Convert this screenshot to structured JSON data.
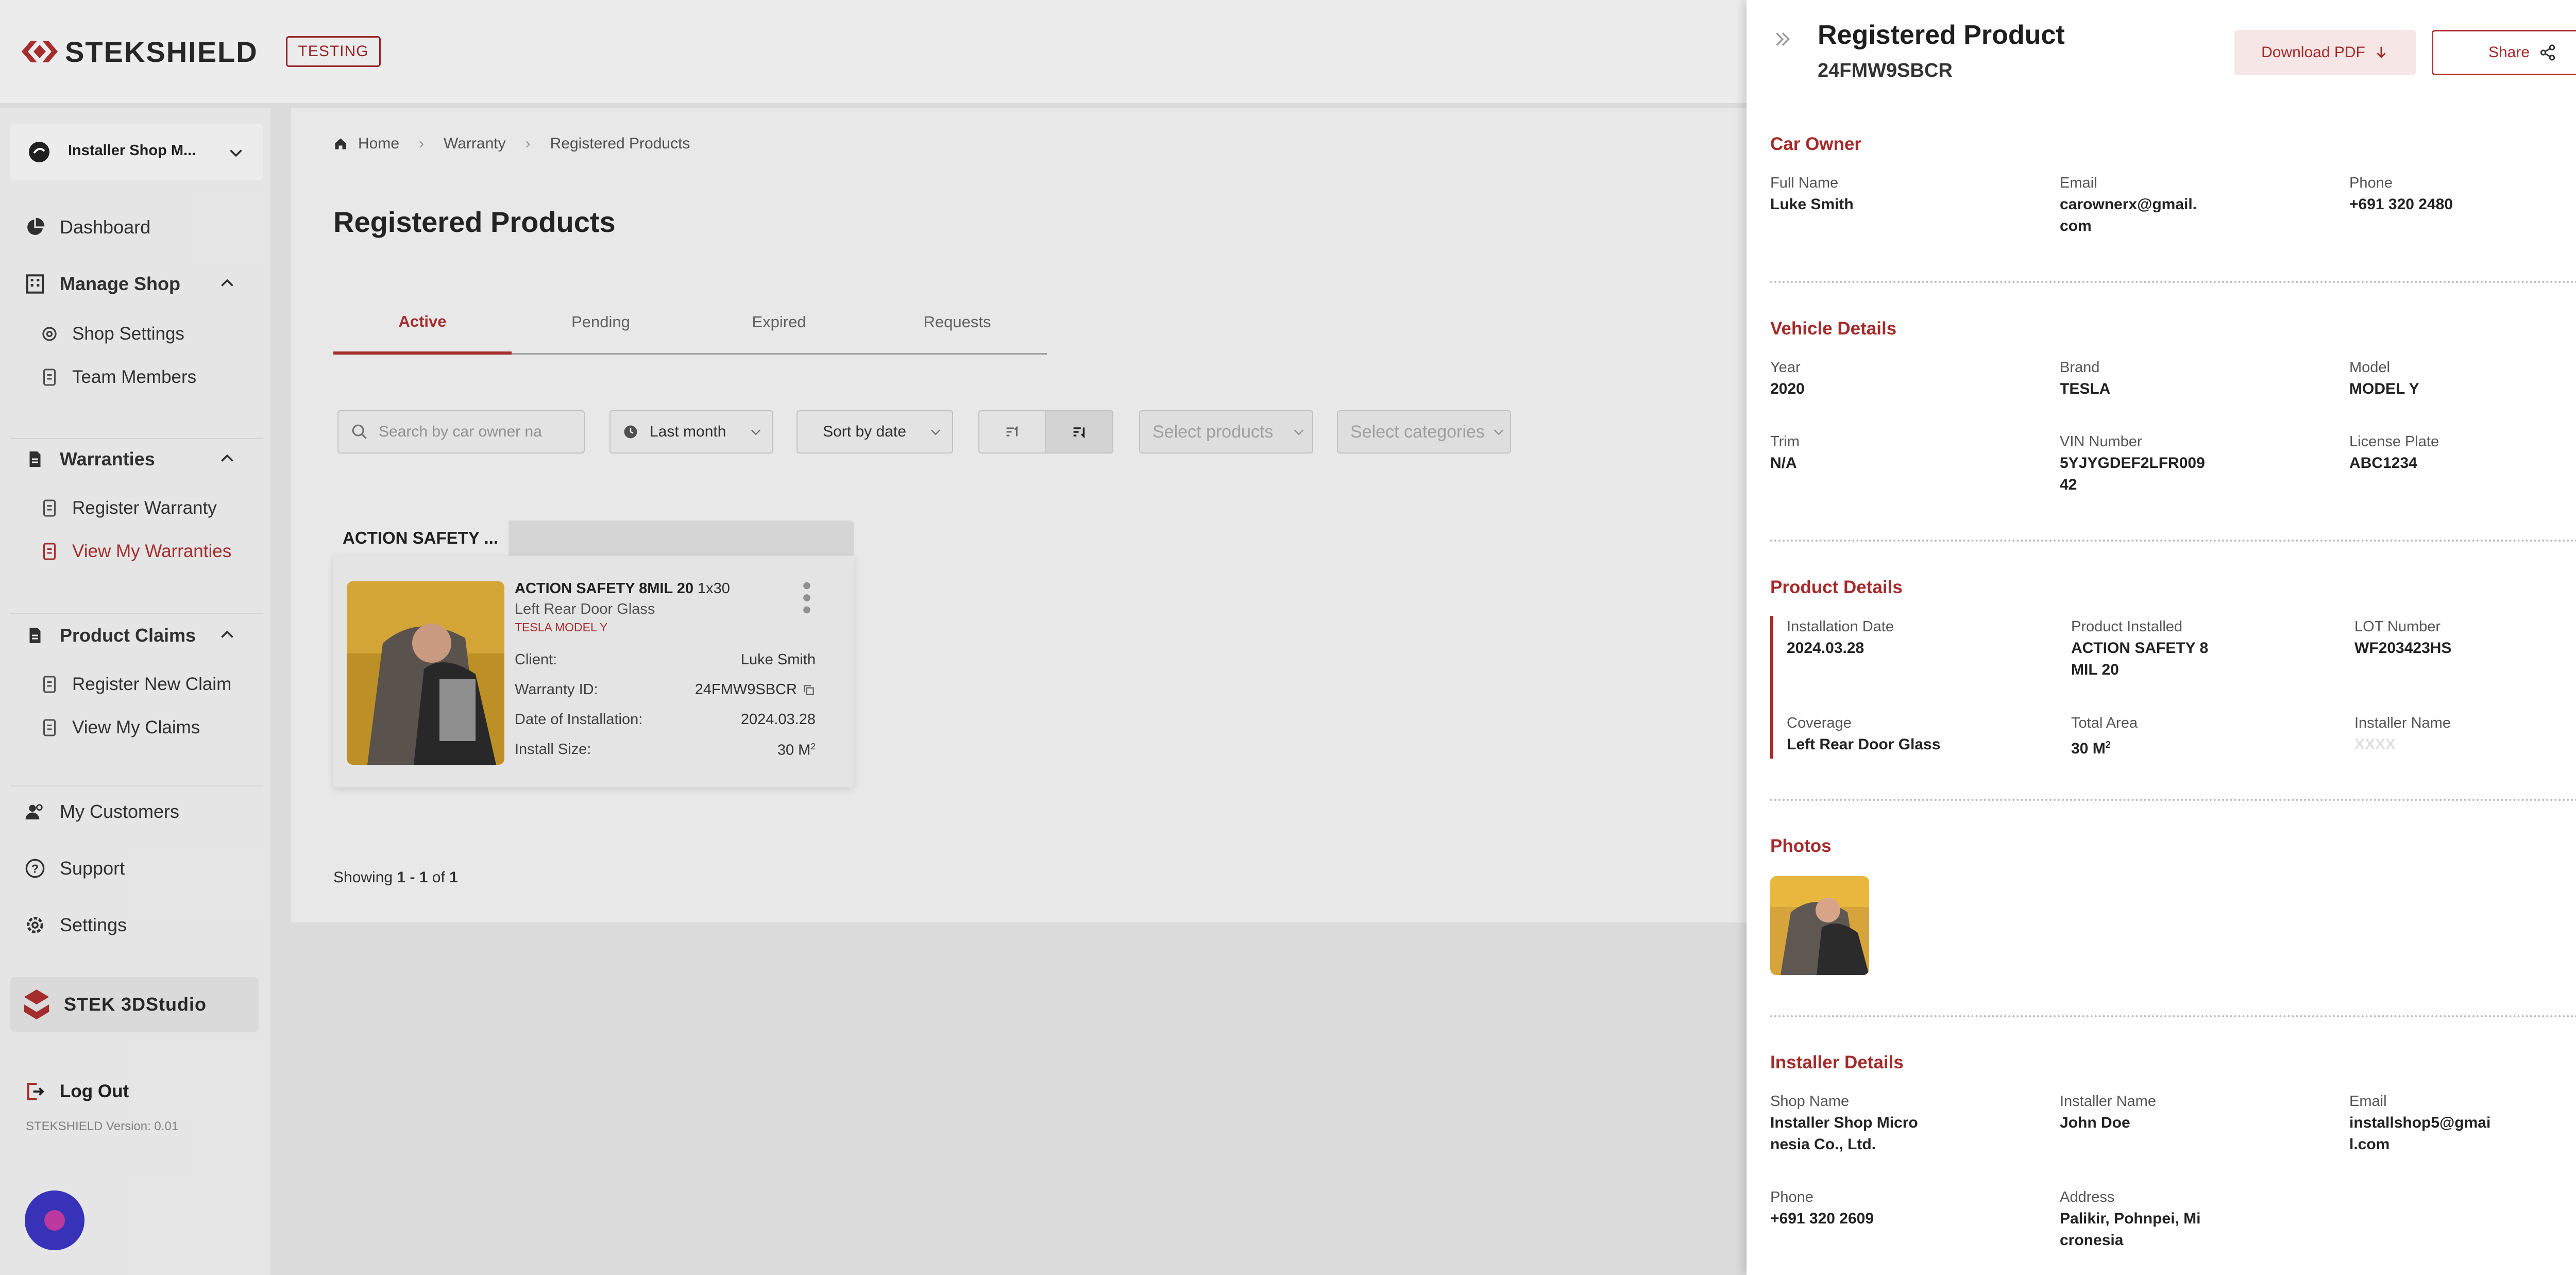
{
  "header": {
    "brand": "STEKSHIELD",
    "env_badge": "TESTING"
  },
  "sidebar": {
    "shop_name": "Installer Shop M...",
    "dashboard": "Dashboard",
    "manage_shop": "Manage Shop",
    "shop_settings": "Shop Settings",
    "team_members": "Team Members",
    "warranties": "Warranties",
    "register_warranty": "Register Warranty",
    "view_my_warranties": "View My Warranties",
    "product_claims": "Product Claims",
    "register_new_claim": "Register New Claim",
    "view_my_claims": "View My Claims",
    "my_customers": "My Customers",
    "support": "Support",
    "settings": "Settings",
    "studio": "STEK 3DStudio",
    "log_out": "Log Out",
    "version": "STEKSHIELD Version: 0.01"
  },
  "breadcrumb": {
    "home": "Home",
    "warranty": "Warranty",
    "current": "Registered Products"
  },
  "page": {
    "title": "Registered Products"
  },
  "tabs": [
    "Active",
    "Pending",
    "Expired",
    "Requests"
  ],
  "filters": {
    "search_placeholder": "Search by car owner na",
    "period": "Last month",
    "sort": "Sort by date",
    "products_placeholder": "Select products",
    "categories_placeholder": "Select categories"
  },
  "group_label": "ACTION SAFETY ...",
  "card": {
    "product_bold": "ACTION SAFETY 8MIL 20",
    "product_size": "1x30",
    "part": "Left Rear Door Glass",
    "vehicle": "TESLA MODEL Y",
    "client_label": "Client:",
    "client_value": "Luke Smith",
    "warranty_label": "Warranty ID:",
    "warranty_value": "24FMW9SBCR",
    "date_label": "Date of Installation:",
    "date_value": "2024.03.28",
    "size_label": "Install Size:",
    "size_value": "30 M",
    "size_sup": "2"
  },
  "pagination": {
    "prefix": "Showing",
    "range": "1 - 1",
    "of": "of",
    "total": "1"
  },
  "panel": {
    "title": "Registered Product",
    "id": "24FMW9SBCR",
    "download_pdf": "Download PDF",
    "share": "Share",
    "car_owner": {
      "title": "Car Owner",
      "full_name_label": "Full Name",
      "full_name": "Luke Smith",
      "email_label": "Email",
      "email": "carownerx@gmail.com",
      "phone_label": "Phone",
      "phone": "+691 320 2480"
    },
    "vehicle": {
      "title": "Vehicle Details",
      "year_label": "Year",
      "year": "2020",
      "brand_label": "Brand",
      "brand": "TESLA",
      "model_label": "Model",
      "model": "MODEL Y",
      "trim_label": "Trim",
      "trim": "N/A",
      "vin_label": "VIN Number",
      "vin": "5YJYGDEF2LFR00942",
      "plate_label": "License Plate",
      "plate": "ABC1234"
    },
    "product": {
      "title": "Product Details",
      "install_date_label": "Installation Date",
      "install_date": "2024.03.28",
      "installed_label": "Product Installed",
      "installed": "ACTION SAFETY 8MIL 20",
      "lot_label": "LOT Number",
      "lot": "WF203423HS",
      "coverage_label": "Coverage",
      "coverage": "Left Rear Door Glass",
      "area_label": "Total Area",
      "area": "30 M",
      "area_sup": "2",
      "installer_label": "Installer Name",
      "installer": "XXXX"
    },
    "photos": {
      "title": "Photos"
    },
    "installer": {
      "title": "Installer Details",
      "shop_label": "Shop Name",
      "shop": "Installer Shop Micronesia Co., Ltd.",
      "name_label": "Installer Name",
      "name": "John Doe",
      "email_label": "Email",
      "email": "installshop5@gmail.com",
      "phone_label": "Phone",
      "phone": "+691 320 2609",
      "address_label": "Address",
      "address": "Palikir, Pohnpei, Micronesia"
    }
  },
  "colors": {
    "accent": "#a52a2a",
    "fab": "#3b36c4"
  }
}
